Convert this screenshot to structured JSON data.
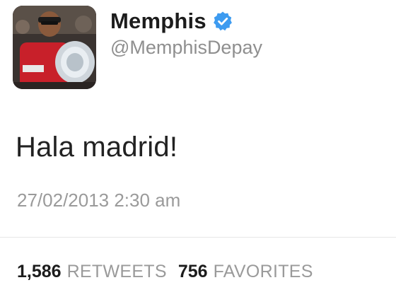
{
  "user": {
    "display_name": "Memphis",
    "handle": "@MemphisDepay",
    "verified": true,
    "verified_color": "#3d9bf0"
  },
  "tweet": {
    "text": "Hala madrid!",
    "timestamp": "27/02/2013 2:30 am"
  },
  "stats": {
    "retweets_count": "1,586",
    "retweets_label": "RETWEETS",
    "favorites_count": "756",
    "favorites_label": "FAVORITES"
  },
  "icons": {
    "verified": "verified-badge-icon",
    "avatar": "profile-avatar-photo"
  }
}
